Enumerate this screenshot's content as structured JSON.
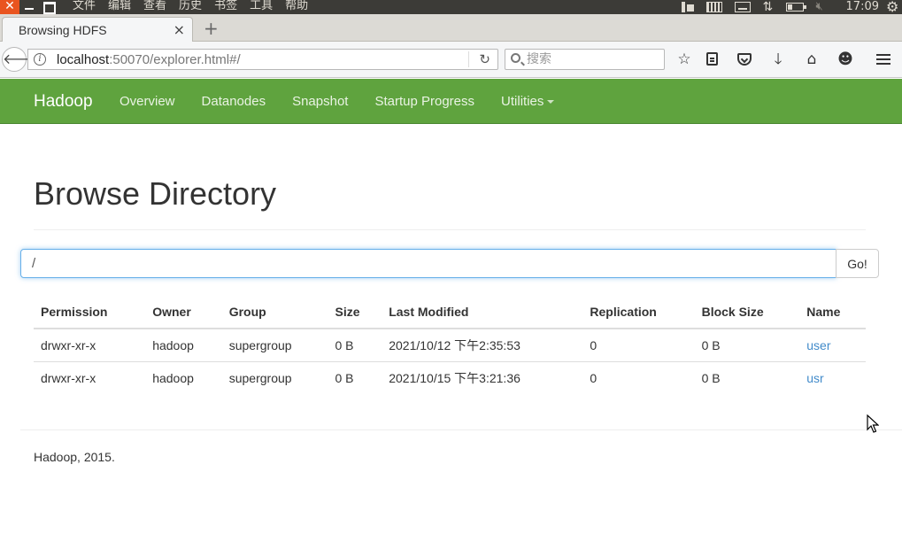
{
  "os": {
    "menu": [
      "文件",
      "编辑",
      "查看",
      "历史",
      "书签",
      "工具",
      "帮助"
    ],
    "close_glyph": "✕",
    "clock": "17:09"
  },
  "browser": {
    "tab_title": "Browsing HDFS",
    "tab_close": "×",
    "new_tab": "+",
    "url_host": "localhost",
    "url_rest": ":50070/explorer.html#/",
    "search_placeholder": "搜索"
  },
  "navbar": {
    "brand": "Hadoop",
    "links": [
      "Overview",
      "Datanodes",
      "Snapshot",
      "Startup Progress",
      "Utilities"
    ],
    "bg_color": "#5fa33e"
  },
  "page": {
    "title": "Browse Directory",
    "path_value": "/",
    "go_label": "Go!"
  },
  "table": {
    "headers": [
      "Permission",
      "Owner",
      "Group",
      "Size",
      "Last Modified",
      "Replication",
      "Block Size",
      "Name"
    ],
    "rows": [
      [
        "drwxr-xr-x",
        "hadoop",
        "supergroup",
        "0 B",
        "2021/10/12 下午2:35:53",
        "0",
        "0 B",
        "user"
      ],
      [
        "drwxr-xr-x",
        "hadoop",
        "supergroup",
        "0 B",
        "2021/10/15 下午3:21:36",
        "0",
        "0 B",
        "usr"
      ]
    ],
    "link_color": "#428bca"
  },
  "footer": {
    "text": "Hadoop, 2015."
  }
}
